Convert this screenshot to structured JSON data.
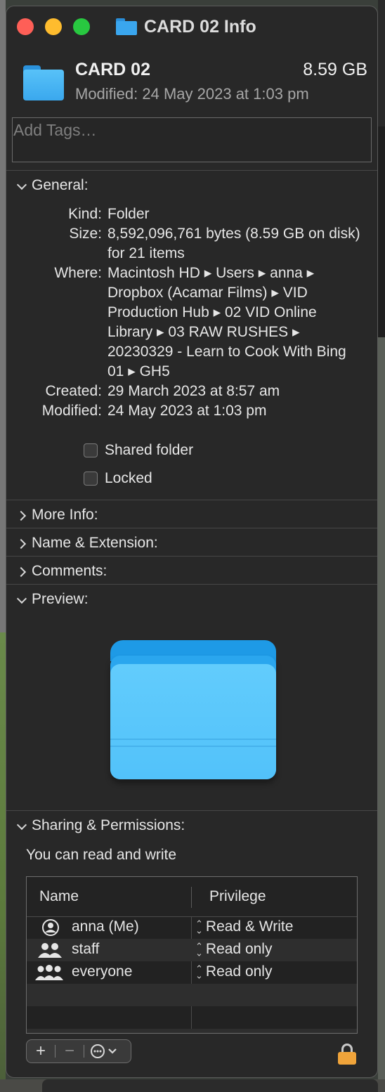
{
  "window": {
    "title": "CARD 02 Info"
  },
  "header": {
    "name": "CARD 02",
    "size": "8.59 GB",
    "modified": "Modified: 24 May 2023 at 1:03 pm"
  },
  "tags": {
    "placeholder": "Add Tags…"
  },
  "general": {
    "heading": "General:",
    "rows": [
      {
        "key": "Kind:",
        "value": "Folder"
      },
      {
        "key": "Size:",
        "value": "8,592,096,761 bytes (8.59 GB on disk) for 21 items"
      },
      {
        "key": "Where:",
        "value": "Macintosh HD ▸ Users ▸ anna ▸ Dropbox (Acamar Films) ▸ VID Production Hub ▸ 02 VID Online Library ▸ 03 RAW RUSHES ▸ 20230329 - Learn to Cook With Bing 01 ▸ GH5"
      },
      {
        "key": "Created:",
        "value": "29 March 2023 at 8:57 am"
      },
      {
        "key": "Modified:",
        "value": "24 May 2023 at 1:03 pm"
      }
    ],
    "shared_folder_label": "Shared folder",
    "locked_label": "Locked",
    "shared_folder_checked": false,
    "locked_checked": false
  },
  "sections": {
    "more_info": "More Info:",
    "name_extension": "Name & Extension:",
    "comments": "Comments:",
    "preview": "Preview:",
    "sharing": "Sharing & Permissions:"
  },
  "sharing": {
    "summary": "You can read and write",
    "columns": [
      "Name",
      "Privilege"
    ],
    "rows": [
      {
        "name": "anna (Me)",
        "privilege": "Read & Write",
        "icon": "user-icon"
      },
      {
        "name": "staff",
        "privilege": "Read only",
        "icon": "group-icon"
      },
      {
        "name": "everyone",
        "privilege": "Read only",
        "icon": "everyone-icon"
      }
    ]
  },
  "toolbar": {
    "add": "+",
    "remove": "−",
    "action_icon": "ellipsis-circle-icon"
  },
  "colors": {
    "folder_blue": "#3aa8ee",
    "lock_orange": "#f0a43a"
  }
}
